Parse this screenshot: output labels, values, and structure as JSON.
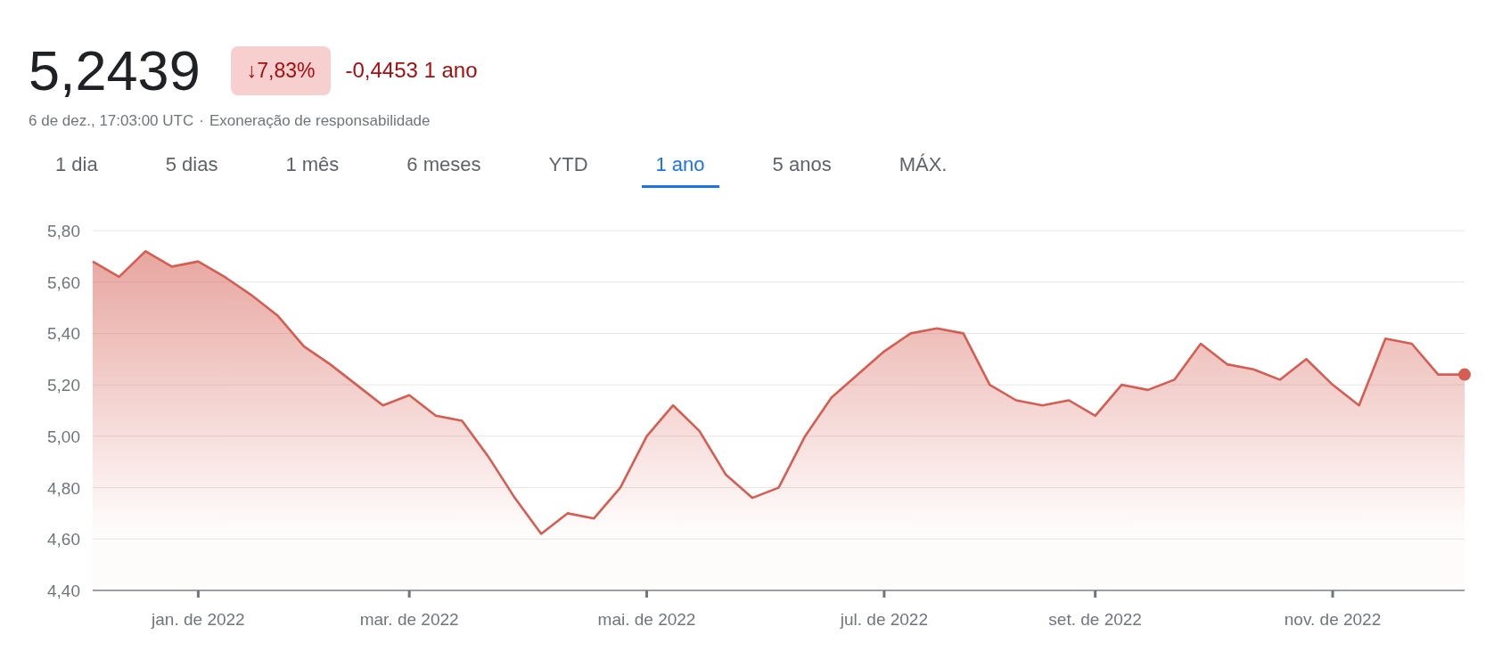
{
  "quote": {
    "price": "5,2439",
    "change_percent": "↓7,83%",
    "change_value": "-0,4453 1 ano",
    "timestamp": "6 de dez., 17:03:00 UTC",
    "separator": "·",
    "disclaimer": "Exoneração de responsabilidade"
  },
  "tabs": [
    {
      "label": "1 dia",
      "selected": false
    },
    {
      "label": "5 dias",
      "selected": false
    },
    {
      "label": "1 mês",
      "selected": false
    },
    {
      "label": "6 meses",
      "selected": false
    },
    {
      "label": "YTD",
      "selected": false
    },
    {
      "label": "1 ano",
      "selected": true
    },
    {
      "label": "5 anos",
      "selected": false
    },
    {
      "label": "MÁX.",
      "selected": false
    }
  ],
  "chart": {
    "chart_data": {
      "type": "area",
      "categories": [
        null,
        null,
        null,
        null,
        "jan. de 2022",
        null,
        null,
        null,
        null,
        null,
        null,
        null,
        "mar. de 2022",
        null,
        null,
        null,
        null,
        null,
        null,
        null,
        null,
        "mai. de 2022",
        null,
        null,
        null,
        null,
        null,
        null,
        null,
        null,
        "jul. de 2022",
        null,
        null,
        null,
        null,
        null,
        null,
        null,
        "set. de 2022",
        null,
        null,
        null,
        null,
        null,
        null,
        null,
        null,
        "nov. de 2022",
        null,
        null,
        null,
        null,
        null
      ],
      "series": [
        {
          "color": "#d55d52",
          "values": [
            5.68,
            5.62,
            5.72,
            5.66,
            5.68,
            5.62,
            5.55,
            5.47,
            5.35,
            5.28,
            5.2,
            5.12,
            5.16,
            5.08,
            5.06,
            4.92,
            4.76,
            4.62,
            4.7,
            4.68,
            4.8,
            5.0,
            5.12,
            5.02,
            4.85,
            4.76,
            4.8,
            5.0,
            5.15,
            5.24,
            5.33,
            5.4,
            5.42,
            5.4,
            5.2,
            5.14,
            5.12,
            5.14,
            5.08,
            5.2,
            5.18,
            5.22,
            5.36,
            5.28,
            5.26,
            5.22,
            5.3,
            5.2,
            5.12,
            5.38,
            5.36,
            5.24,
            5.24
          ]
        }
      ],
      "ylim": [
        4.4,
        5.8
      ],
      "grid": true,
      "yticks": [
        {
          "value": 4.4,
          "label": "4,40"
        },
        {
          "value": 4.6,
          "label": "4,60"
        },
        {
          "value": 4.8,
          "label": "4,80"
        },
        {
          "value": 5.0,
          "label": "5,00"
        },
        {
          "value": 5.2,
          "label": "5,20"
        },
        {
          "value": 5.4,
          "label": "5,40"
        },
        {
          "value": 5.6,
          "label": "5,60"
        },
        {
          "value": 5.8,
          "label": "5,80"
        }
      ]
    }
  }
}
